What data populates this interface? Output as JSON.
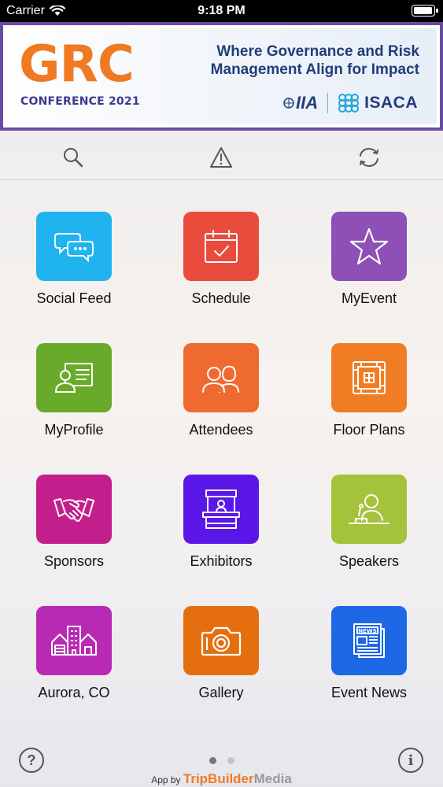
{
  "status_bar": {
    "carrier": "Carrier",
    "time": "9:18 PM"
  },
  "banner": {
    "logo_main": "GRC",
    "logo_sub": "CONFERENCE 2021",
    "tagline_line1": "Where Governance and Risk",
    "tagline_line2": "Management Align for Impact",
    "partner1": "IIA",
    "partner2": "ISACA",
    "colors": {
      "border": "#6a4ba3",
      "orange": "#f07a21",
      "navy": "#213d7a"
    }
  },
  "toolbar": {
    "search_icon": "search-icon",
    "alert_icon": "warning-icon",
    "refresh_icon": "refresh-icon"
  },
  "tiles": [
    {
      "label": "Social Feed",
      "icon": "chat-bubbles-icon",
      "color": "#1fb4f0"
    },
    {
      "label": "Schedule",
      "icon": "calendar-check-icon",
      "color": "#e94b3c"
    },
    {
      "label": "MyEvent",
      "icon": "star-icon",
      "color": "#8e4fb7"
    },
    {
      "label": "MyProfile",
      "icon": "profile-card-icon",
      "color": "#6aaa2a"
    },
    {
      "label": "Attendees",
      "icon": "people-icon",
      "color": "#ef6a2e"
    },
    {
      "label": "Floor Plans",
      "icon": "floor-plan-icon",
      "color": "#f07d23"
    },
    {
      "label": "Sponsors",
      "icon": "handshake-icon",
      "color": "#c21e8c"
    },
    {
      "label": "Exhibitors",
      "icon": "booth-icon",
      "color": "#5a17e8"
    },
    {
      "label": "Speakers",
      "icon": "speaker-podium-icon",
      "color": "#a4c23a"
    },
    {
      "label": "Aurora, CO",
      "icon": "city-icon",
      "color": "#b92ab4"
    },
    {
      "label": "Gallery",
      "icon": "camera-icon",
      "color": "#e56f0f"
    },
    {
      "label": "Event News",
      "icon": "newspaper-icon",
      "color": "#1e67e6"
    }
  ],
  "footer": {
    "help_label": "?",
    "info_label": "i",
    "credit_prefix": "App by",
    "credit_brand": "TripBuilder",
    "credit_brand2": "Media",
    "page_count": 2,
    "active_page": 1
  }
}
